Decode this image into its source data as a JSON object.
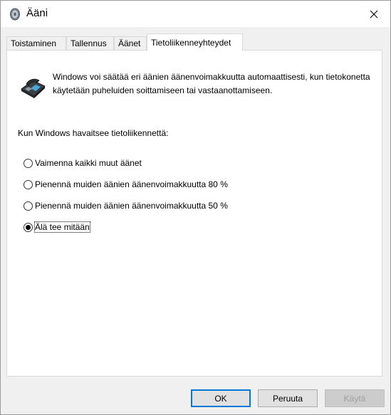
{
  "window": {
    "title": "Ääni"
  },
  "tabs": [
    {
      "label": "Toistaminen",
      "active": false
    },
    {
      "label": "Tallennus",
      "active": false
    },
    {
      "label": "Äänet",
      "active": false
    },
    {
      "label": "Tietoliikenneyhteydet",
      "active": true
    }
  ],
  "communications": {
    "description": "Windows voi säätää eri äänien äänenvoimakkuutta automaattisesti, kun tietokonetta käytetään puheluiden soittamiseen tai vastaanottamiseen.",
    "detect_label": "Kun Windows havaitsee tietoliikennettä:",
    "options": [
      {
        "label": "Vaimenna kaikki muut äänet",
        "selected": false
      },
      {
        "label": "Pienennä muiden äänien äänenvoimakkuutta 80 %",
        "selected": false
      },
      {
        "label": "Pienennä muiden äänien äänenvoimakkuutta 50 %",
        "selected": false
      },
      {
        "label": "Älä tee mitään",
        "selected": true
      }
    ]
  },
  "buttons": {
    "ok": "OK",
    "cancel": "Peruuta",
    "apply": "Käytä"
  },
  "colors": {
    "accent": "#0078d7",
    "panel": "#ffffff",
    "background": "#f0f0f0"
  }
}
